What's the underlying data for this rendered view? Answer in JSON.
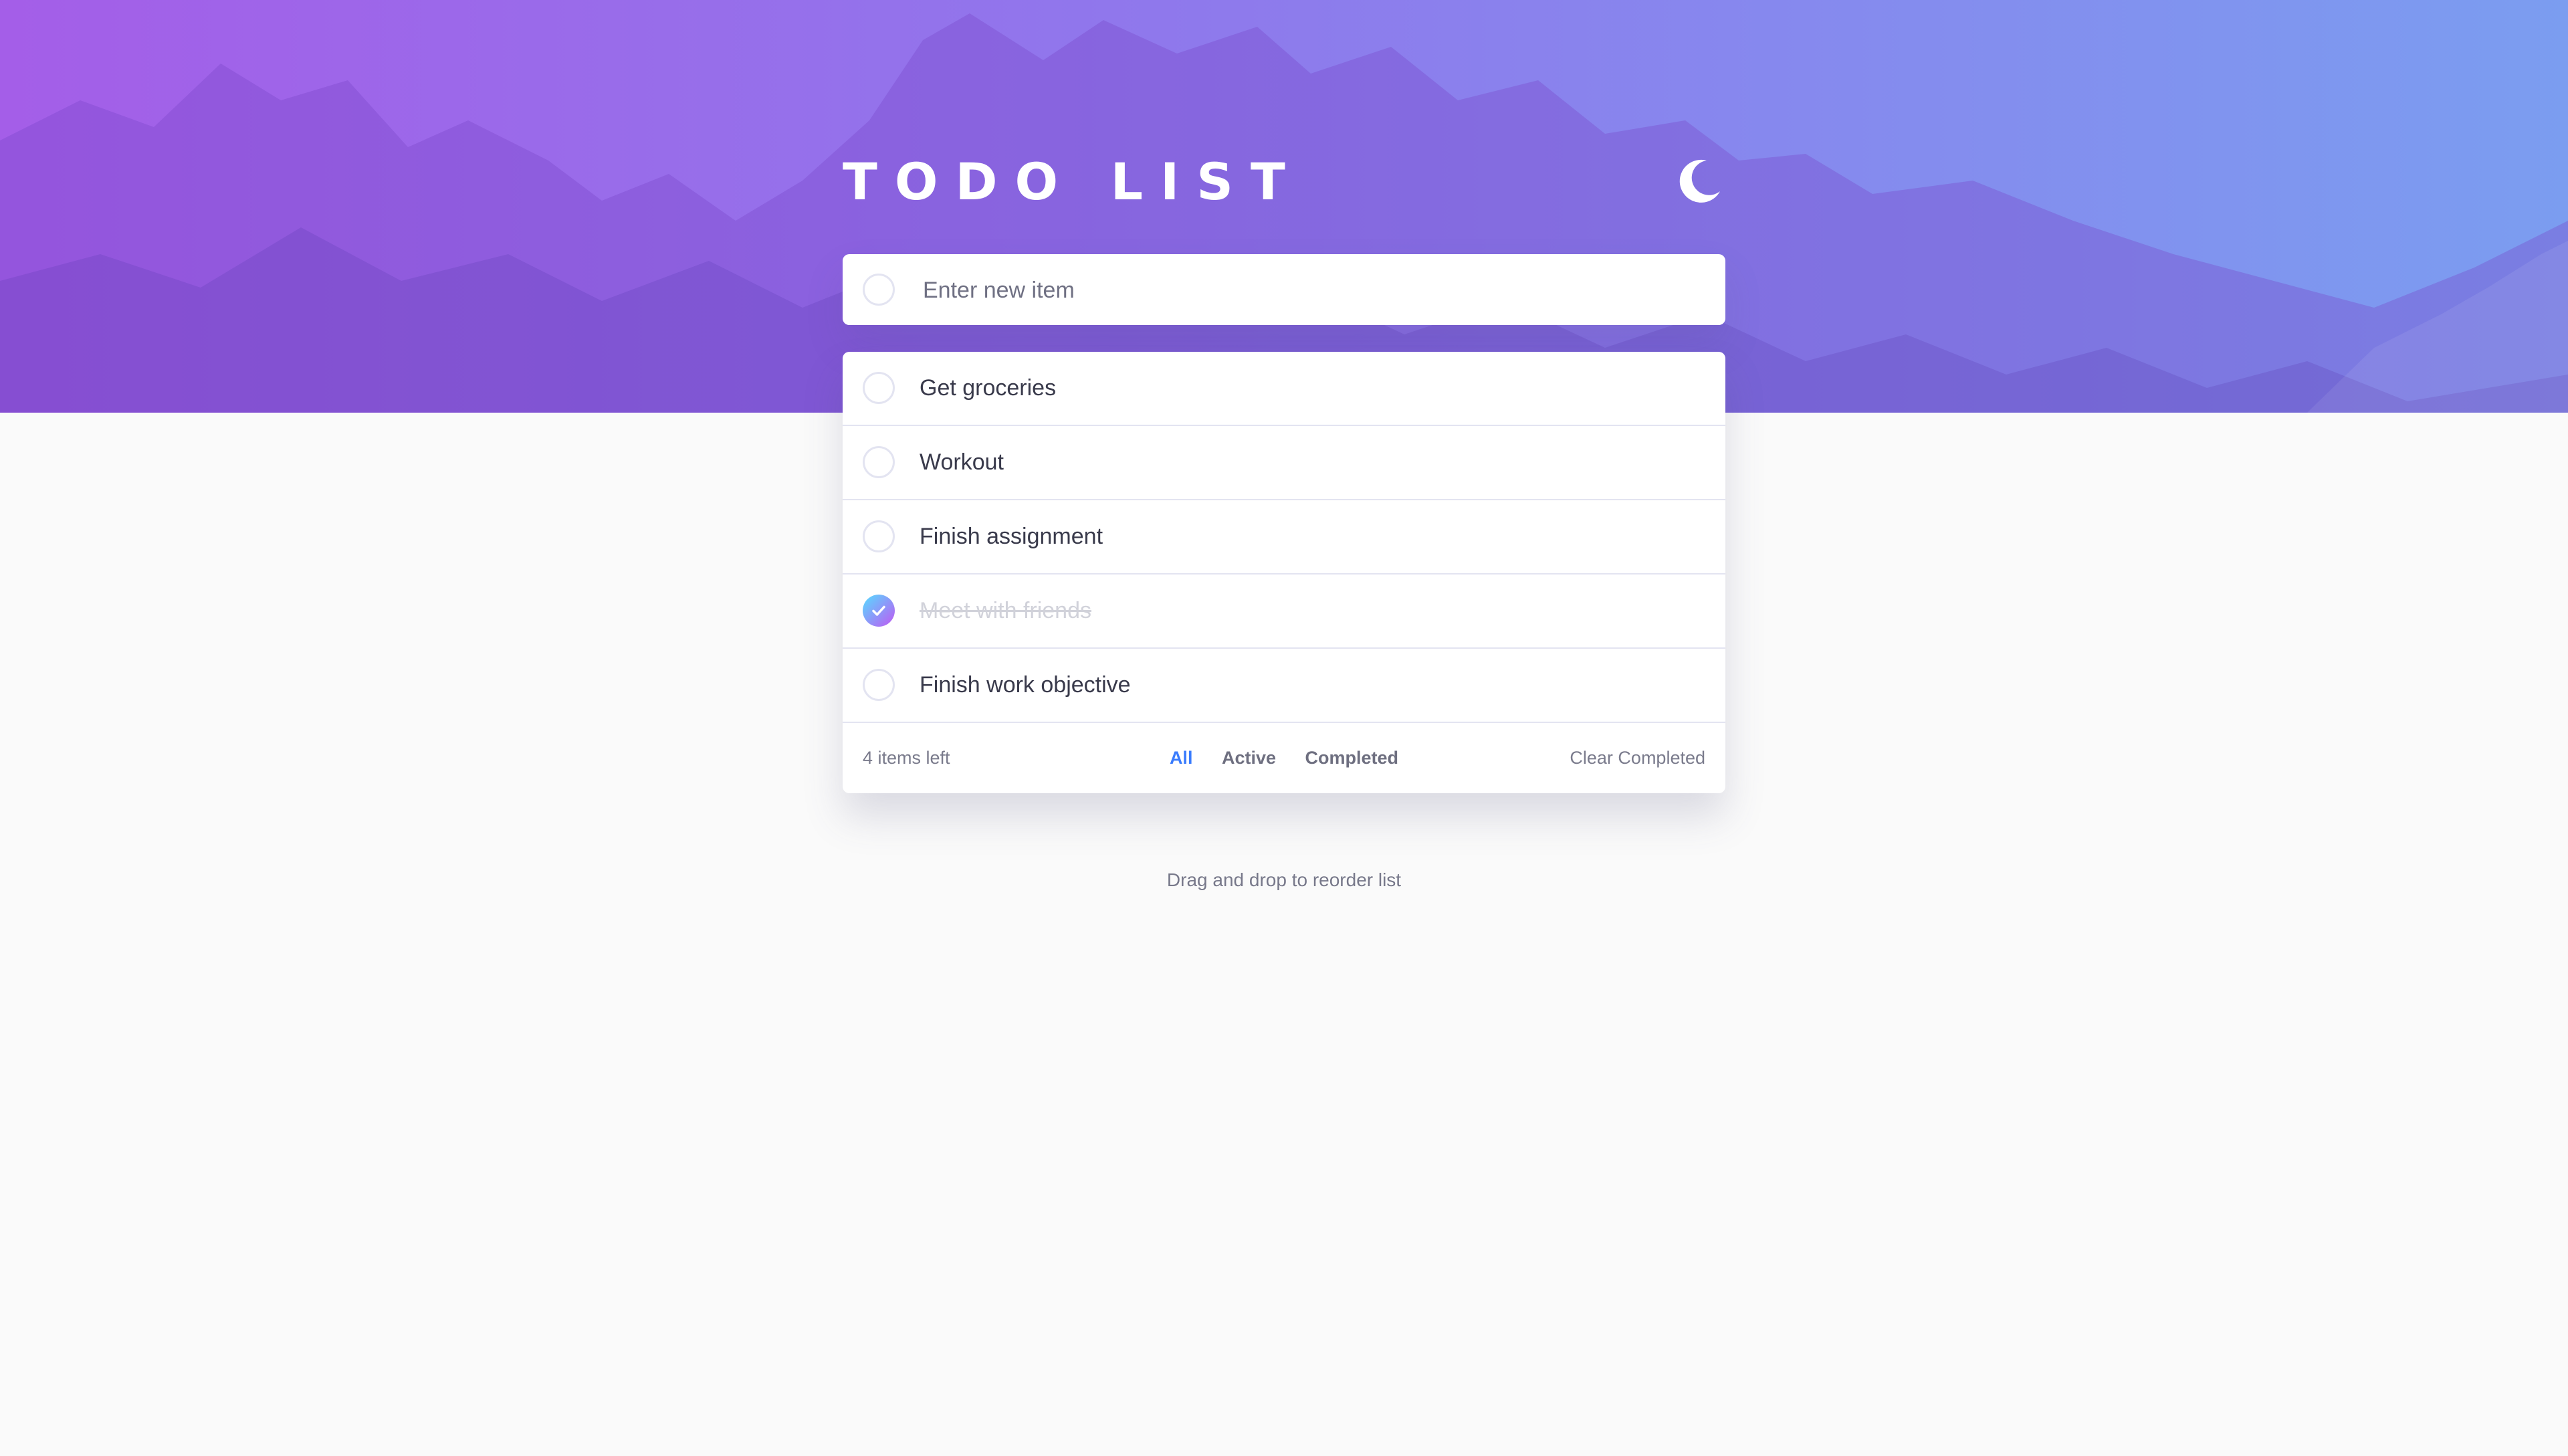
{
  "header": {
    "title": "TODO LIST",
    "theme_icon": "moon-icon"
  },
  "new_item": {
    "placeholder": "Enter new item"
  },
  "todos": [
    {
      "label": "Get groceries",
      "completed": false
    },
    {
      "label": "Workout",
      "completed": false
    },
    {
      "label": "Finish assignment",
      "completed": false
    },
    {
      "label": "Meet with friends",
      "completed": true
    },
    {
      "label": "Finish work objective",
      "completed": false
    }
  ],
  "footer": {
    "items_left": "4 items left",
    "filters": [
      {
        "label": "All",
        "active": true
      },
      {
        "label": "Active",
        "active": false
      },
      {
        "label": "Completed",
        "active": false
      }
    ],
    "clear_label": "Clear Completed"
  },
  "hint": "Drag and drop to reorder list",
  "colors": {
    "accent": "#3a7cfd",
    "check_gradient_start": "#55ddff",
    "check_gradient_end": "#c058f3",
    "hero_start": "#a45ee8",
    "hero_end": "#7b9df0"
  }
}
